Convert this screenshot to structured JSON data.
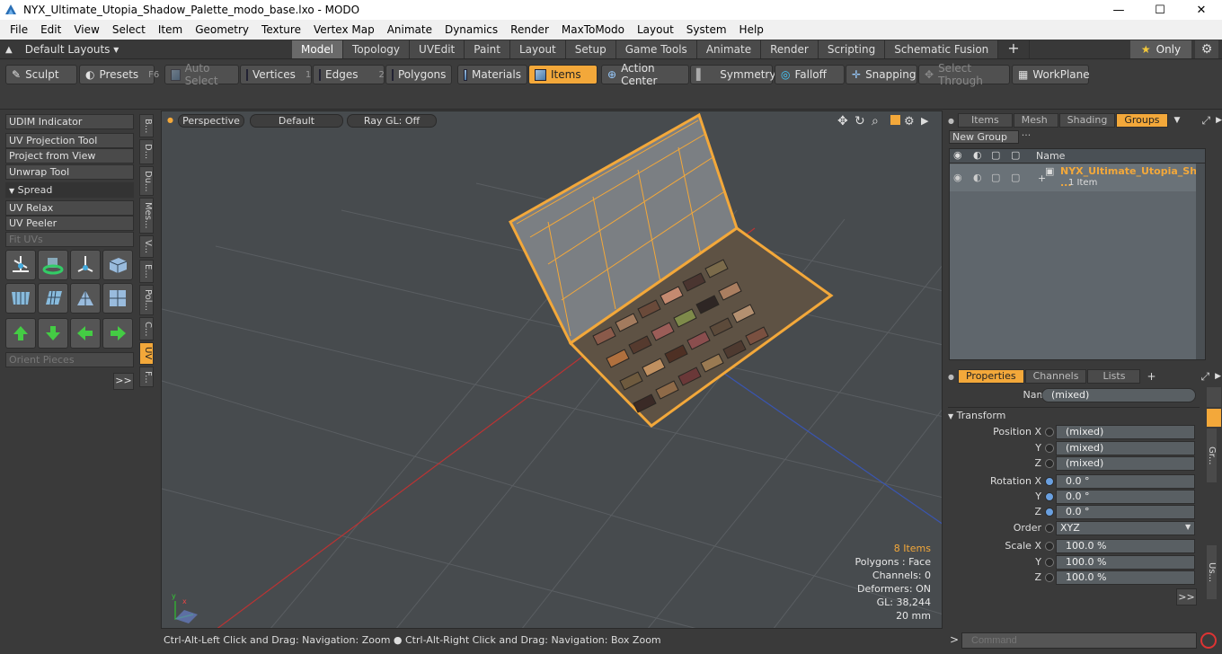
{
  "window": {
    "title": "NYX_Ultimate_Utopia_Shadow_Palette_modo_base.lxo - MODO",
    "minimize": "—",
    "maximize": "☐",
    "close": "✕"
  },
  "menu": [
    "File",
    "Edit",
    "View",
    "Select",
    "Item",
    "Geometry",
    "Texture",
    "Vertex Map",
    "Animate",
    "Dynamics",
    "Render",
    "MaxToModo",
    "Layout",
    "System",
    "Help"
  ],
  "layoutbar": {
    "layouts_label": "Default Layouts ▾",
    "tabs": [
      "Model",
      "Topology",
      "UVEdit",
      "Paint",
      "Layout",
      "Setup",
      "Game Tools",
      "Animate",
      "Render",
      "Scripting",
      "Schematic Fusion",
      "+"
    ],
    "active_tab": "Model",
    "only_label": "Only"
  },
  "toolbar": {
    "sculpt": "Sculpt",
    "presets": "Presets",
    "presets_key": "F6",
    "auto_select": "Auto Select",
    "vertices": "Vertices",
    "vertices_key": "1",
    "edges": "Edges",
    "edges_key": "2",
    "polygons": "Polygons",
    "materials": "Materials",
    "items": "Items",
    "action_center": "Action Center",
    "symmetry": "Symmetry",
    "falloff": "Falloff",
    "snapping": "Snapping",
    "select_through": "Select Through",
    "workplane": "WorkPlane"
  },
  "leftpanel": {
    "udim": "UDIM Indicator",
    "uv_projection": "UV Projection Tool",
    "project_from_view": "Project from View",
    "unwrap": "Unwrap Tool",
    "spread": "Spread",
    "uv_relax": "UV Relax",
    "uv_peeler": "UV Peeler",
    "fit_uvs": "Fit UVs",
    "orient_pieces": "Orient Pieces",
    "more": ">>",
    "vtabs": [
      "B...",
      "D...",
      "Du...",
      "Mes...",
      "V...",
      "E...",
      "Pol...",
      "C...",
      "UV",
      "F..."
    ]
  },
  "viewport": {
    "perspective": "Perspective",
    "default": "Default",
    "raygl": "Ray GL: Off",
    "items_count": "8 Items",
    "polygons": "Polygons : Face",
    "channels": "Channels: 0",
    "deformers": "Deformers: ON",
    "gl": "GL: 38,244",
    "scale": "20 mm"
  },
  "status": "Ctrl-Alt-Left Click and Drag: Navigation: Zoom ● Ctrl-Alt-Right Click and Drag: Navigation: Box Zoom",
  "rightpanel": {
    "top_tabs": [
      "Items",
      "Mesh ...",
      "Shading",
      "Groups"
    ],
    "active_top": "Groups",
    "new_group": "New Group",
    "name_col": "Name",
    "group_name": "NYX_Ultimate_Utopia_Sh ...",
    "group_count": "1 Item",
    "bottom_tabs": [
      "Properties",
      "Channels",
      "Lists",
      "+"
    ],
    "active_bottom": "Properties",
    "name_label": "Name",
    "name_val": "(mixed)",
    "transform": "Transform",
    "position_label": "Position X",
    "pos_x": "(mixed)",
    "pos_y": "(mixed)",
    "pos_z": "(mixed)",
    "rotation_label": "Rotation X",
    "rot_x": "0.0 °",
    "rot_y": "0.0 °",
    "rot_z": "0.0 °",
    "order_label": "Order",
    "order_val": "XYZ",
    "scale_label": "Scale X",
    "scale_x": "100.0 %",
    "scale_y": "100.0 %",
    "scale_z": "100.0 %",
    "y": "Y",
    "z": "Z",
    "more": ">>",
    "side_tabs": [
      "Gr...",
      "Us..."
    ]
  },
  "command": {
    "placeholder": "Command",
    "prompt": ">"
  }
}
